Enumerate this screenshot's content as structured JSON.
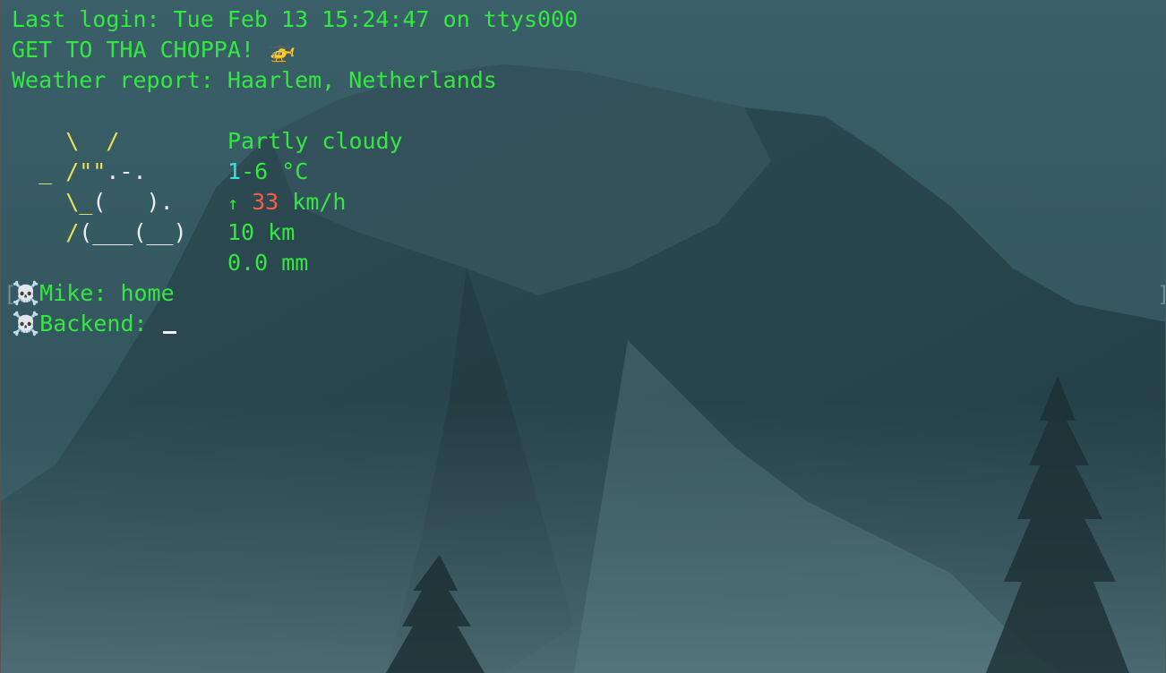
{
  "terminal": {
    "last_login": "Last login: Tue Feb 13 15:24:47 on ttys000",
    "choppa_text": "GET TO THA CHOPPA!",
    "choppa_emoji": "🚁",
    "weather_header": "Weather report: Haarlem, Netherlands"
  },
  "weather": {
    "art_line1": "    \\  /",
    "art_line2_sun": "  _ /\"\"",
    "art_line2_cloud": ".-.",
    "art_line3_sun": "    \\_",
    "art_line3_cloud": "(   ).",
    "art_line4_sun": "    /",
    "art_line4_cloud": "(___(__)",
    "condition": "Partly cloudy",
    "temp_low": "1",
    "temp_rest": "-6 °C",
    "wind_arrow": "↑",
    "wind_speed": "33",
    "wind_unit": " km/h",
    "visibility": "10 km",
    "precipitation": "0.0 mm"
  },
  "prompts": {
    "skull_emoji": "☠️",
    "line1": "Mike: home",
    "line2": "Backend: ",
    "bracket_left": "[",
    "bracket_right": "]"
  },
  "colors": {
    "text": "#33e840",
    "sun": "#e8e055",
    "cloud": "#eeeeee",
    "temp": "#3ae0e0",
    "wind_speed": "#ff5a48",
    "background": "#2c4d55"
  }
}
